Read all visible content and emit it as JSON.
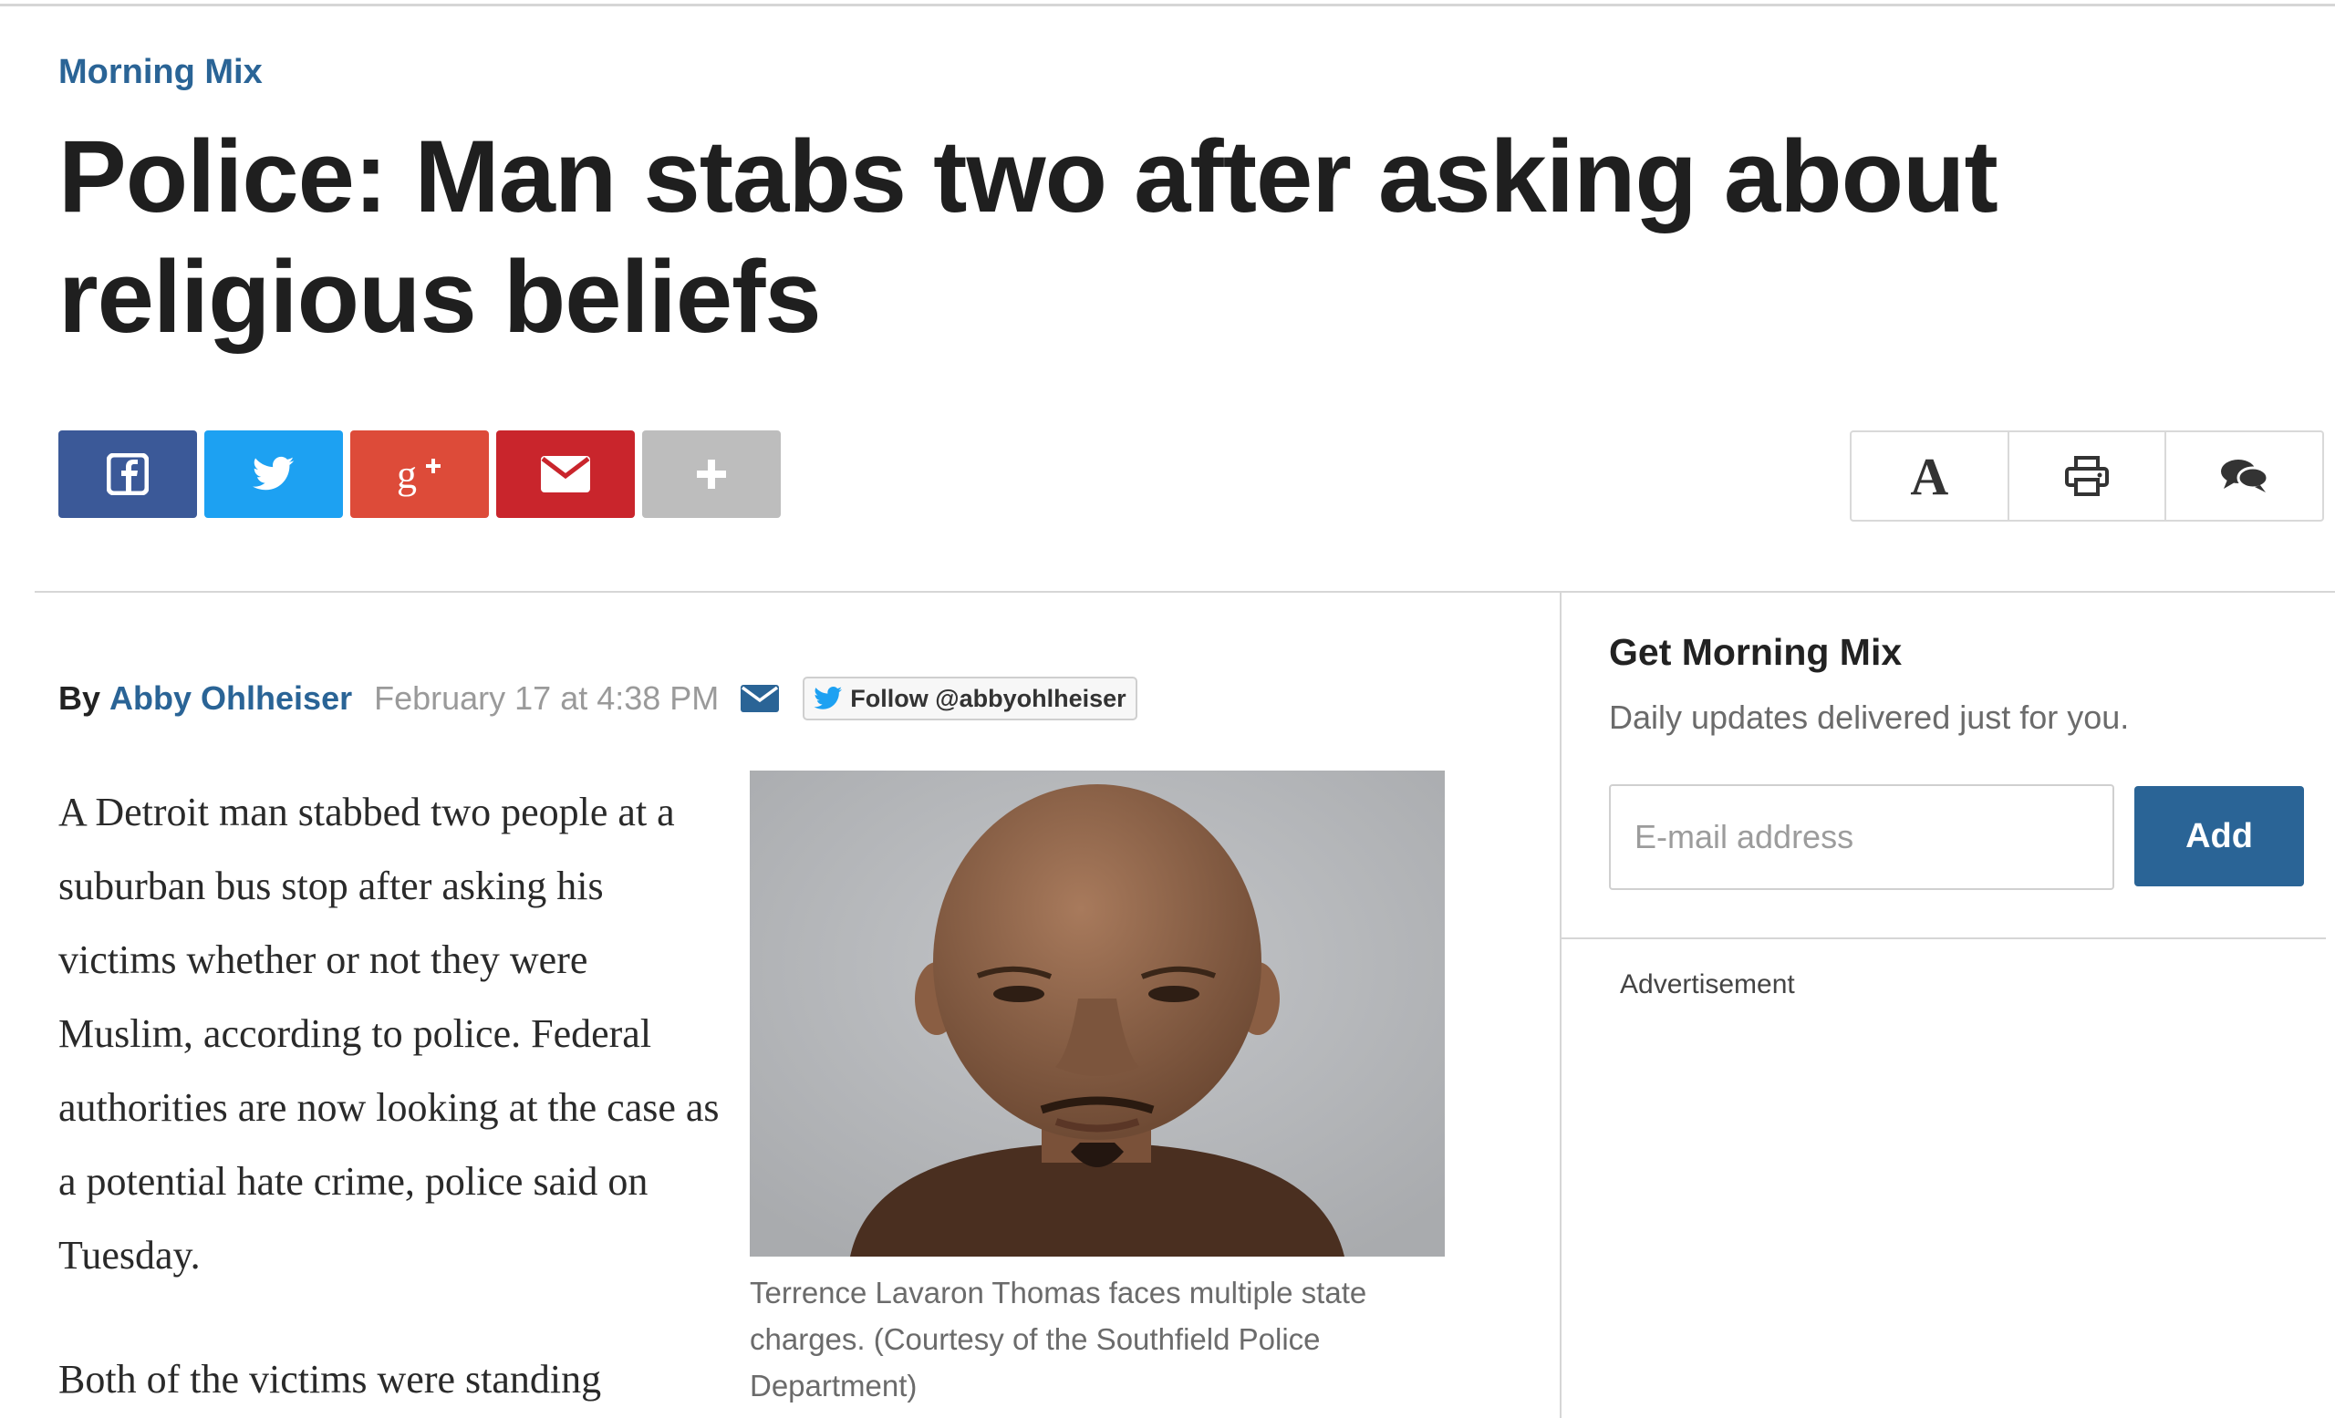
{
  "article": {
    "kicker": "Morning Mix",
    "headline": "Police: Man stabs two after asking about religious beliefs",
    "byline": {
      "prefix": "By",
      "author": "Abby Ohlheiser",
      "date": "February 17 at 4:38 PM",
      "follow_label": "Follow @abbyohlheiser"
    },
    "paragraphs": [
      "A Detroit man stabbed two people at a suburban bus stop after asking his victims whether or not they were Muslim, according to police. Federal authorities are now looking at the case as a potential hate crime, police said on Tuesday.",
      "Both of the victims were standing"
    ],
    "photo_caption": "Terrence Lavaron Thomas faces multiple state charges. (Courtesy of the Southfield Police Department)"
  },
  "share_buttons": [
    {
      "icon": "facebook-icon",
      "color": "#3b5998"
    },
    {
      "icon": "twitter-icon",
      "color": "#1da1f2"
    },
    {
      "icon": "google-plus-icon",
      "color": "#dd4b39"
    },
    {
      "icon": "email-icon",
      "color": "#c9252c"
    },
    {
      "icon": "plus-icon",
      "color": "#bdbdbd"
    }
  ],
  "tools": {
    "font_label": "A",
    "icons": [
      "font-size-icon",
      "print-icon",
      "comments-icon"
    ]
  },
  "newsletter": {
    "title": "Get Morning Mix",
    "description": "Daily updates delivered just for you.",
    "email_placeholder": "E-mail address",
    "button_label": "Add"
  },
  "advertisement_label": "Advertisement",
  "colors": {
    "accent": "#2a6496",
    "headline": "#1f1f1f",
    "muted": "#9a9a9a"
  }
}
